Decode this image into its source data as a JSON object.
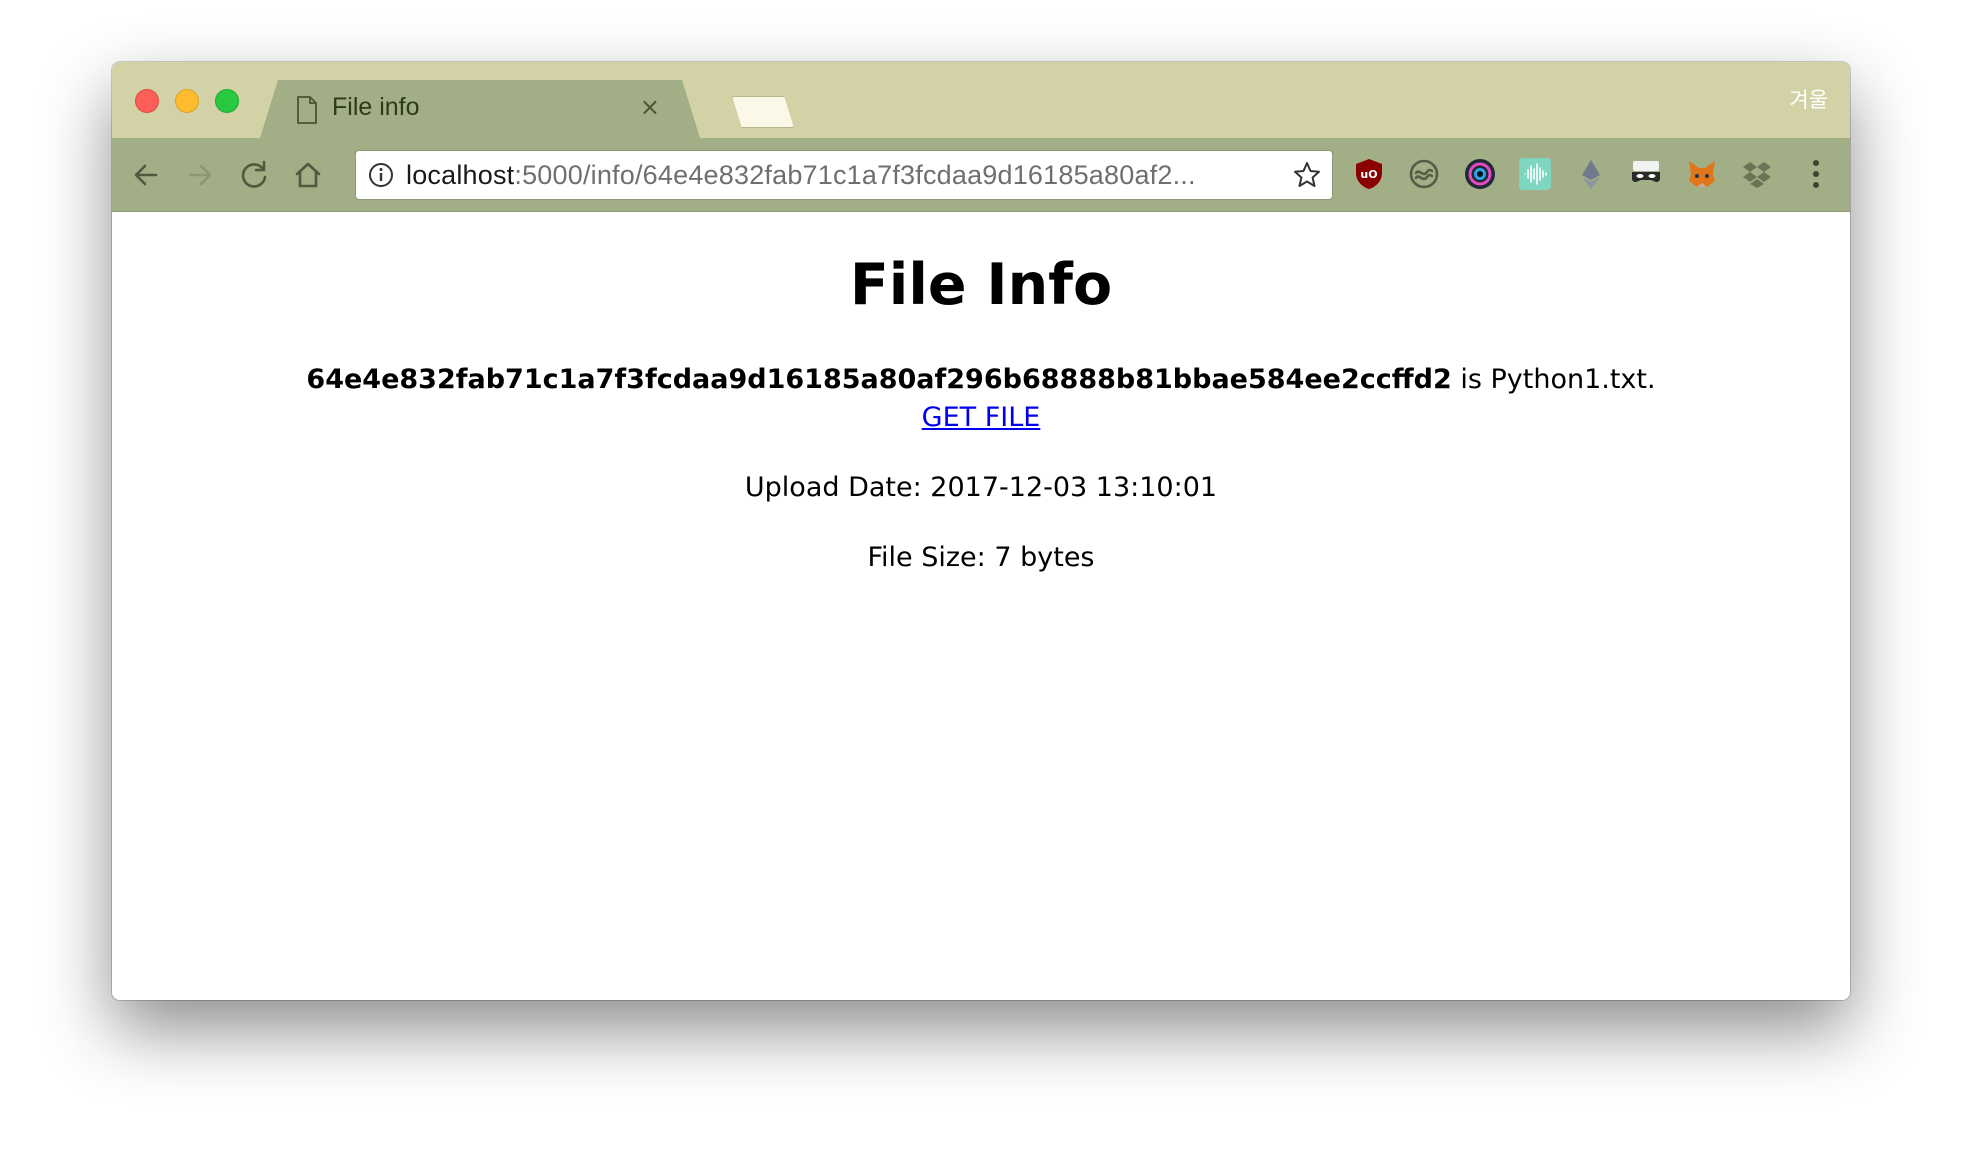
{
  "browser": {
    "tab": {
      "title": "File info",
      "close_glyph": "×",
      "icon": "document-icon"
    },
    "profile_name": "겨울",
    "address": {
      "host": "localhost",
      "path": ":5000/info/64e4e832fab71c1a7f3fcdaa9d16185a80af2..."
    },
    "extensions": [
      "ublock-icon",
      "sync-icon",
      "camera-lens-icon",
      "audio-wave-icon",
      "ethereum-icon",
      "mask-icon",
      "metamask-fox-icon",
      "dropbox-icon"
    ],
    "colors": {
      "titlebar": "#d3d2a6",
      "toolbar": "#a2ae85",
      "link": "#0000ee"
    }
  },
  "page": {
    "title": "File Info",
    "hash": "64e4e832fab71c1a7f3fcdaa9d16185a80af296b68888b81bbae584ee2ccffd2",
    "is_text": " is Python1.txt.",
    "get_file_label": "GET FILE",
    "upload_date": "Upload Date: 2017-12-03 13:10:01",
    "file_size": "File Size: 7 bytes"
  }
}
